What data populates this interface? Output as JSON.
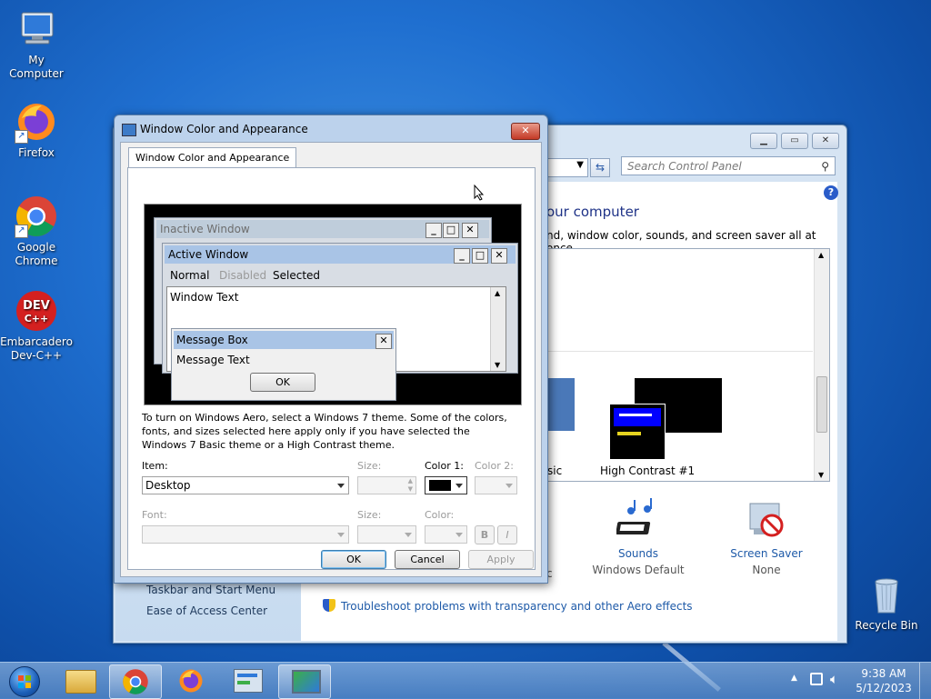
{
  "desktop": {
    "icons": [
      {
        "label": "My Computer",
        "icon": "computer-icon"
      },
      {
        "label": "Firefox",
        "icon": "firefox-icon"
      },
      {
        "label": "Google Chrome",
        "icon": "chrome-icon"
      },
      {
        "label": "Embarcadero Dev-C++",
        "icon": "devcpp-icon",
        "logo_text": "DEV C++"
      },
      {
        "label": "Recycle Bin",
        "icon": "recycle-bin-icon"
      }
    ]
  },
  "control_panel": {
    "search_placeholder": "Search Control Panel",
    "heading": "our computer",
    "subheading": "nd, window color, sounds, and screen saver all at once.",
    "themes": [
      {
        "label": "sic"
      },
      {
        "label": "High Contrast #1"
      }
    ],
    "items": [
      {
        "label": "Sounds",
        "value": "Windows Default",
        "icon": "sounds-icon"
      },
      {
        "label": "Screen Saver",
        "value": "None",
        "icon": "screen-saver-icon"
      }
    ],
    "partial_c": "c",
    "left_links": [
      "Taskbar and Start Menu",
      "Ease of Access Center"
    ],
    "troubleshoot_link": "Troubleshoot problems with transparency and other Aero effects"
  },
  "dialog": {
    "title": "Window Color and Appearance",
    "tab_label": "Window Color and Appearance",
    "preview": {
      "inactive_title": "Inactive Window",
      "active_title": "Active Window",
      "menu": [
        "Normal",
        "Disabled",
        "Selected"
      ],
      "window_text": "Window Text",
      "message_box_title": "Message Box",
      "message_text": "Message Text",
      "ok_label": "OK"
    },
    "info_text": "To turn on Windows Aero, select a Windows 7 theme.  Some of the colors, fonts, and sizes selected here apply only if you have selected the Windows 7 Basic theme or a High Contrast theme.",
    "item_label": "Item:",
    "item_value": "Desktop",
    "size_label": "Size:",
    "color1_label": "Color 1:",
    "color2_label": "Color 2:",
    "font_label": "Font:",
    "font_size_label": "Size:",
    "font_color_label": "Color:",
    "bold_label": "B",
    "italic_label": "I",
    "buttons": {
      "ok": "OK",
      "cancel": "Cancel",
      "apply": "Apply"
    },
    "color1_value": "#000000"
  },
  "taskbar": {
    "time": "9:38 AM",
    "date": "5/12/2023",
    "buttons": [
      "start-orb-icon",
      "explorer-icon",
      "chrome-icon",
      "firefox-icon",
      "control-panel-icon",
      "display-settings-icon"
    ]
  },
  "colors": {
    "accent": "#1a5fc8",
    "link": "#1e5aa8",
    "selected_bar": "#a9c4e6",
    "inactive_bar": "#bfcddb"
  }
}
